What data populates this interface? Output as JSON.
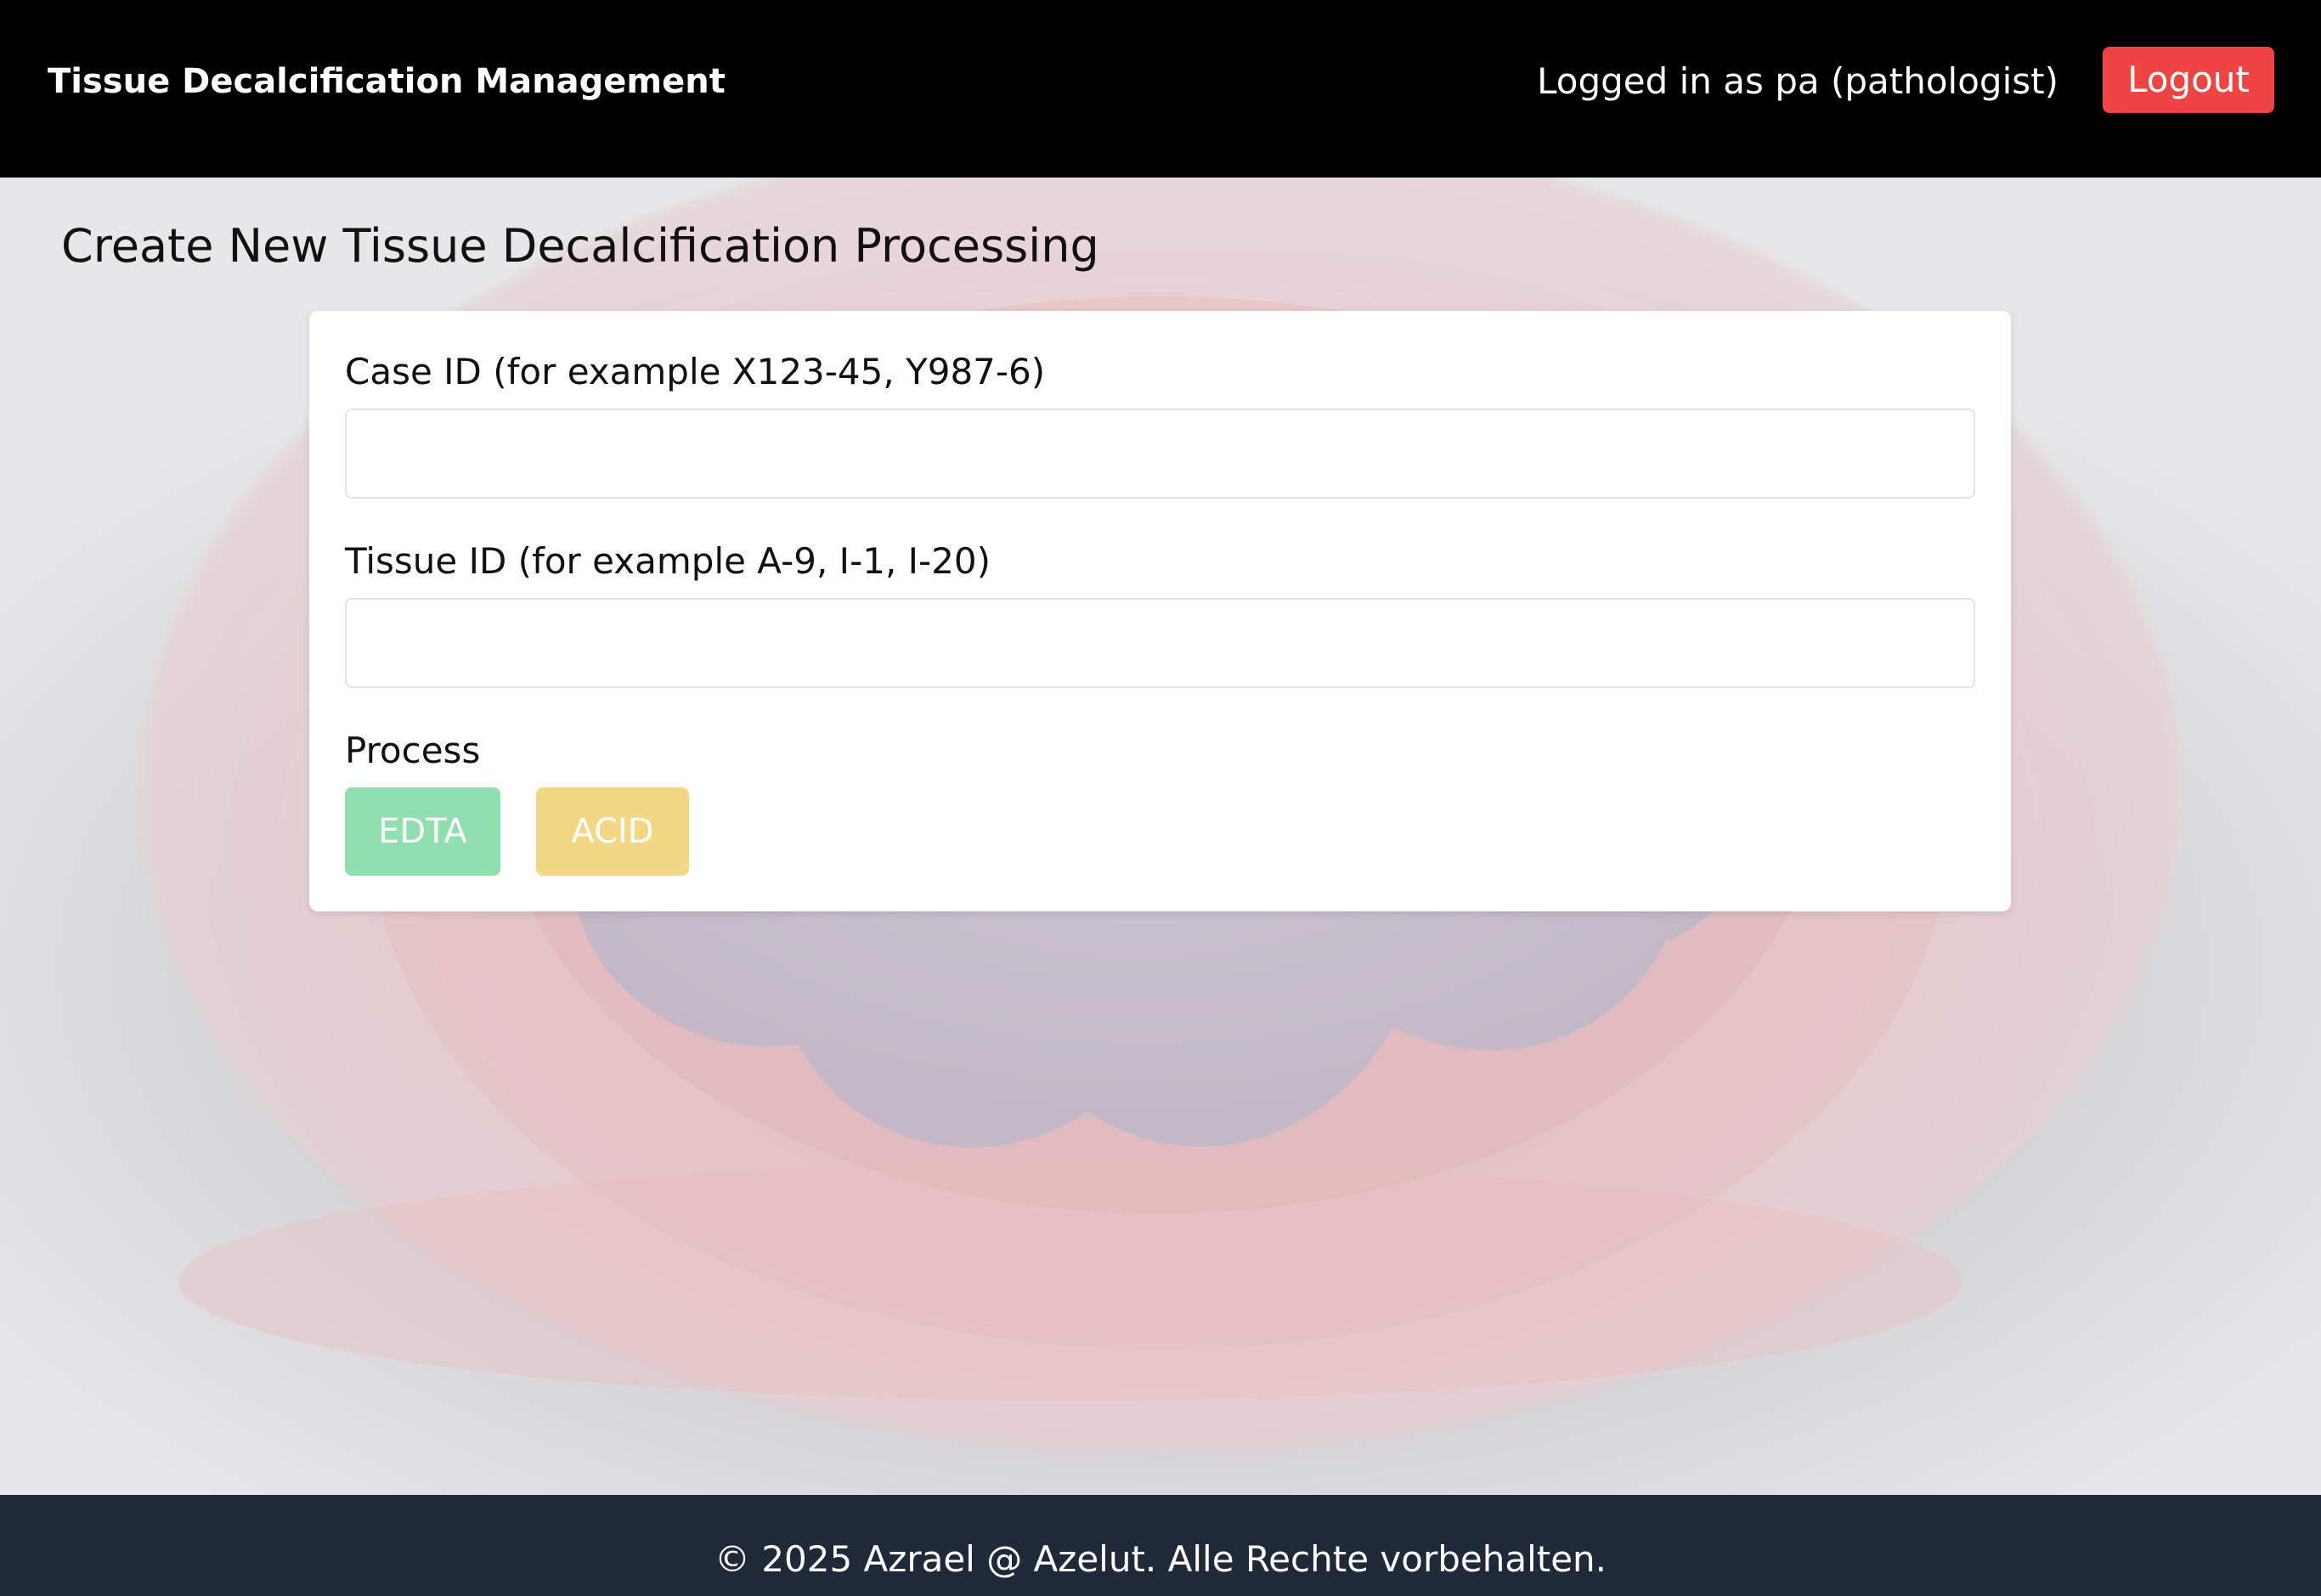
{
  "header": {
    "brand": "Tissue Decalcification Management",
    "user_status": "Logged in as pa (pathologist)",
    "logout_label": "Logout"
  },
  "page": {
    "title": "Create New Tissue Decalcification Processing"
  },
  "form": {
    "case_id": {
      "label": "Case ID (for example X123-45, Y987-6)",
      "value": "",
      "placeholder": ""
    },
    "tissue_id": {
      "label": "Tissue ID (for example A-9, I-1, I-20)",
      "value": "",
      "placeholder": ""
    },
    "process": {
      "label": "Process",
      "options": [
        {
          "label": "EDTA",
          "color": "#8fe0ae"
        },
        {
          "label": "ACID",
          "color": "#f2d884"
        }
      ]
    }
  },
  "footer": {
    "text": "© 2025 Azrael @ Azelut. Alle Rechte vorbehalten."
  },
  "colors": {
    "header_bg": "#000000",
    "logout_bg": "#ef4444",
    "footer_bg": "#1f2937",
    "card_bg": "#ffffff"
  }
}
